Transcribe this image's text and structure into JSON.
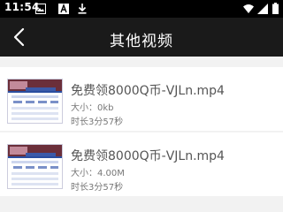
{
  "status_bar": {
    "time": "11:54",
    "icons": [
      "gallery-icon",
      "text-a-icon",
      "download-icon",
      "wifi-icon",
      "signal-icon",
      "battery-icon"
    ]
  },
  "header": {
    "back_icon": "chevron-left-icon",
    "title": "其他视频"
  },
  "videos": [
    {
      "title": "免费领8000Q币-VJLn.mp4",
      "size_label": "大小：",
      "size": "0kb",
      "duration": "时长3分57秒"
    },
    {
      "title": "免费领8000Q币-VJLn.mp4",
      "size_label": "大小：",
      "size": "4.00M",
      "duration": "时长3分57秒"
    }
  ],
  "colors": {
    "status_bar": "#000000",
    "title_bar": "#1a1a1a",
    "background": "#f2f2f2",
    "item_background": "#ffffff"
  }
}
